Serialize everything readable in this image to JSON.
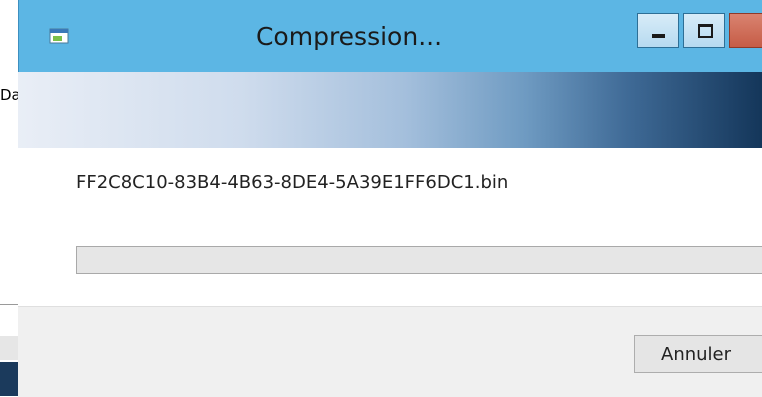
{
  "background_window": {
    "partial_text": "Da"
  },
  "dialog": {
    "title": "Compression...",
    "icons": {
      "app": "app-icon",
      "minimize": "minimize-icon",
      "maximize": "maximize-icon",
      "close": "close-icon"
    },
    "colors": {
      "frame": "#5cb6e4",
      "close_button": "#c65c46",
      "progress_fill": "#06b025"
    },
    "file_name": "FF2C8C10-83B4-4B63-8DE4-5A39E1FF6DC1.bin",
    "progress": 0,
    "cancel_label": "Annuler"
  }
}
